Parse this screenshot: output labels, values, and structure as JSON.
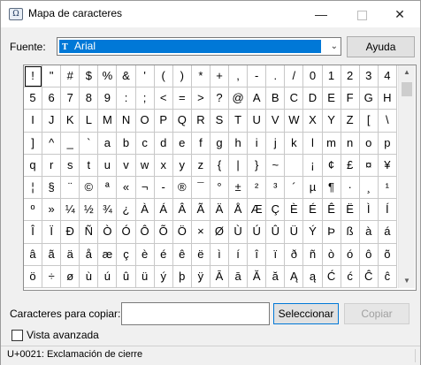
{
  "window": {
    "title": "Mapa de caracteres",
    "controls": {
      "minimize": "—",
      "close": "✕"
    }
  },
  "font": {
    "label": "Fuente:",
    "selected": "Arial",
    "type_icon": "truetype-icon"
  },
  "buttons": {
    "help": "Ayuda",
    "select": "Seleccionar",
    "copy": "Copiar"
  },
  "grid": {
    "rows": [
      [
        "!",
        "\"",
        "#",
        "$",
        "%",
        "&",
        "'",
        "(",
        ")",
        "*",
        "+",
        ",",
        "-",
        ".",
        "/",
        "0",
        "1",
        "2",
        "3",
        "4"
      ],
      [
        "5",
        "6",
        "7",
        "8",
        "9",
        ":",
        ";",
        "<",
        "=",
        ">",
        "?",
        "@",
        "A",
        "B",
        "C",
        "D",
        "E",
        "F",
        "G",
        "H"
      ],
      [
        "I",
        "J",
        "K",
        "L",
        "M",
        "N",
        "O",
        "P",
        "Q",
        "R",
        "S",
        "T",
        "U",
        "V",
        "W",
        "X",
        "Y",
        "Z",
        "[",
        "\\"
      ],
      [
        "]",
        "^",
        "_",
        "`",
        "a",
        "b",
        "c",
        "d",
        "e",
        "f",
        "g",
        "h",
        "i",
        "j",
        "k",
        "l",
        "m",
        "n",
        "o",
        "p"
      ],
      [
        "q",
        "r",
        "s",
        "t",
        "u",
        "v",
        "w",
        "x",
        "y",
        "z",
        "{",
        "|",
        "}",
        "~",
        " ",
        "¡",
        "¢",
        "£",
        "¤",
        "¥"
      ],
      [
        "¦",
        "§",
        "¨",
        "©",
        "ª",
        "«",
        "¬",
        "-",
        "®",
        "¯",
        "°",
        "±",
        "²",
        "³",
        "´",
        "µ",
        "¶",
        "·",
        "¸",
        "¹"
      ],
      [
        "º",
        "»",
        "¼",
        "½",
        "¾",
        "¿",
        "À",
        "Á",
        "Â",
        "Ã",
        "Ä",
        "Å",
        "Æ",
        "Ç",
        "È",
        "É",
        "Ê",
        "Ë",
        "Ì",
        "Í"
      ],
      [
        "Î",
        "Ï",
        "Ð",
        "Ñ",
        "Ò",
        "Ó",
        "Ô",
        "Õ",
        "Ö",
        "×",
        "Ø",
        "Ù",
        "Ú",
        "Û",
        "Ü",
        "Ý",
        "Þ",
        "ß",
        "à",
        "á"
      ],
      [
        "â",
        "ã",
        "ä",
        "å",
        "æ",
        "ç",
        "è",
        "é",
        "ê",
        "ë",
        "ì",
        "í",
        "î",
        "ï",
        "ð",
        "ñ",
        "ò",
        "ó",
        "ô",
        "õ"
      ],
      [
        "ö",
        "÷",
        "ø",
        "ù",
        "ú",
        "û",
        "ü",
        "ý",
        "þ",
        "ÿ",
        "Ā",
        "ā",
        "Ă",
        "ă",
        "Ą",
        "ą",
        "Ć",
        "ć",
        "Ĉ",
        "ĉ"
      ]
    ],
    "selected_index": [
      0,
      0
    ]
  },
  "copy": {
    "label": "Caracteres para copiar:",
    "value": ""
  },
  "advanced": {
    "label": "Vista avanzada",
    "checked": false
  },
  "status": {
    "text": "U+0021: Exclamación de cierre"
  },
  "colors": {
    "selection": "#0078d7",
    "window_bg": "#f0f0f0",
    "grid_line": "#c8c8c8"
  }
}
